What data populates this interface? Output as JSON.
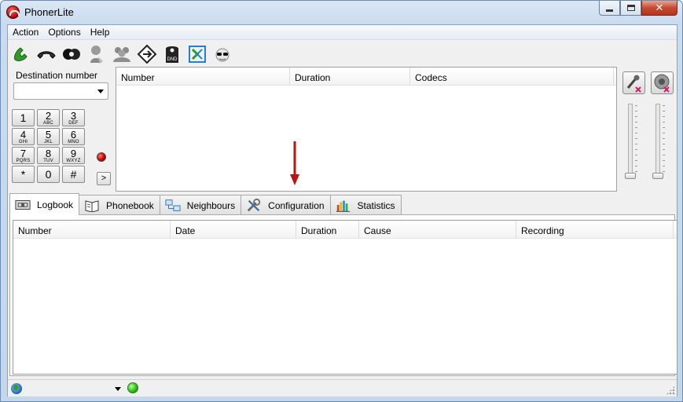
{
  "window": {
    "title": "PhonerLite"
  },
  "menu": [
    "Action",
    "Options",
    "Help"
  ],
  "toolbar": [
    {
      "icon": "phone-pickup-icon",
      "name": "dial-button"
    },
    {
      "icon": "phone-hangup-icon",
      "name": "hangup-button"
    },
    {
      "icon": "hold-icon",
      "name": "hold-button"
    },
    {
      "icon": "transfer-person-icon",
      "name": "transfer-button"
    },
    {
      "icon": "conference-icon",
      "name": "conference-button"
    },
    {
      "icon": "forward-diamond-icon",
      "name": "call-forward-button"
    },
    {
      "icon": "dnd-icon",
      "name": "do-not-disturb-button",
      "badge": "DND"
    },
    {
      "icon": "callback-icon",
      "name": "callback-button"
    },
    {
      "icon": "anonymous-icon",
      "name": "anonymous-button"
    }
  ],
  "dialer": {
    "label": "Destination number",
    "value": "",
    "keys": [
      {
        "d": "1",
        "l": ""
      },
      {
        "d": "2",
        "l": "ABC"
      },
      {
        "d": "3",
        "l": "DEF"
      },
      {
        "d": "4",
        "l": "GHI"
      },
      {
        "d": "5",
        "l": "JKL"
      },
      {
        "d": "6",
        "l": "MNO"
      },
      {
        "d": "7",
        "l": "PQRS"
      },
      {
        "d": "8",
        "l": "TUV"
      },
      {
        "d": "9",
        "l": "WXYZ"
      },
      {
        "d": "*",
        "l": ""
      },
      {
        "d": "0",
        "l": ""
      },
      {
        "d": "#",
        "l": ""
      }
    ],
    "forward_label": ">"
  },
  "calls_table": {
    "columns": [
      "Number",
      "Duration",
      "Codecs"
    ]
  },
  "audio": {
    "microphone_muted": true,
    "speaker_muted": true,
    "mic_level": 0,
    "speaker_level": 0
  },
  "tabs": [
    {
      "label": "Logbook",
      "icon": "logbook-icon",
      "active": true
    },
    {
      "label": "Phonebook",
      "icon": "phonebook-icon",
      "active": false
    },
    {
      "label": "Neighbours",
      "icon": "network-icon",
      "active": false
    },
    {
      "label": "Configuration",
      "icon": "tools-icon",
      "active": false
    },
    {
      "label": "Statistics",
      "icon": "statistics-icon",
      "active": false
    }
  ],
  "logbook": {
    "columns": [
      "Number",
      "Date",
      "Duration",
      "Cause",
      "Recording"
    ],
    "rows": []
  },
  "statusbar": {
    "account": "",
    "registration": "",
    "status_color": "#2fbf17"
  },
  "colors": {
    "arrow": "#b81414",
    "accent": "#1f6fd0"
  }
}
